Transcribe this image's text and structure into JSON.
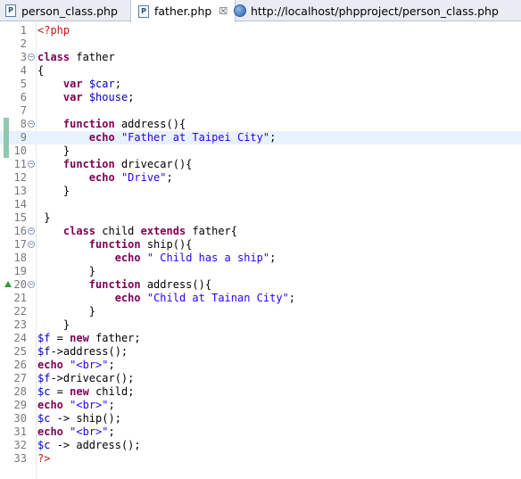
{
  "tabs": [
    {
      "label": "person_class.php",
      "icon": "php-file-icon"
    },
    {
      "label": "father.php",
      "icon": "php-file-icon",
      "close": "☒"
    },
    {
      "label": "http://localhost/phpproject/person_class.php",
      "icon": "globe-icon"
    }
  ],
  "editor": {
    "language": "php",
    "current_line": 9,
    "lines": [
      "<?php",
      "",
      "class father",
      "{",
      "    var $car;",
      "    var $house;",
      "",
      "    function address(){",
      "        echo \"Father at Taipei City\";",
      "    }",
      "    function drivecar(){",
      "        echo \"Drive\";",
      "    }",
      "",
      " }",
      "    class child extends father{",
      "        function ship(){",
      "            echo \" Child has a ship\";",
      "        }",
      "        function address(){",
      "            echo \"Child at Tainan City\";",
      "        }",
      "    }",
      "$f = new father;",
      "$f->address();",
      "echo \"<br>\";",
      "$f->drivecar();",
      "$c = new child;",
      "echo \"<br>\";",
      "$c -> ship();",
      "echo \"<br>\";",
      "$c -> address();",
      "?>"
    ],
    "fold_lines": [
      3,
      8,
      11,
      16,
      17,
      20
    ],
    "change_marker_lines": [
      8,
      9,
      10
    ],
    "override_marker_lines": [
      20
    ]
  },
  "colors": {
    "keyword": "#7f0055",
    "string": "#2a00ff",
    "variable": "#0000c0",
    "php_tag": "#c01818",
    "line_number": "#787878",
    "current_line_bg": "#e8f2fe"
  }
}
